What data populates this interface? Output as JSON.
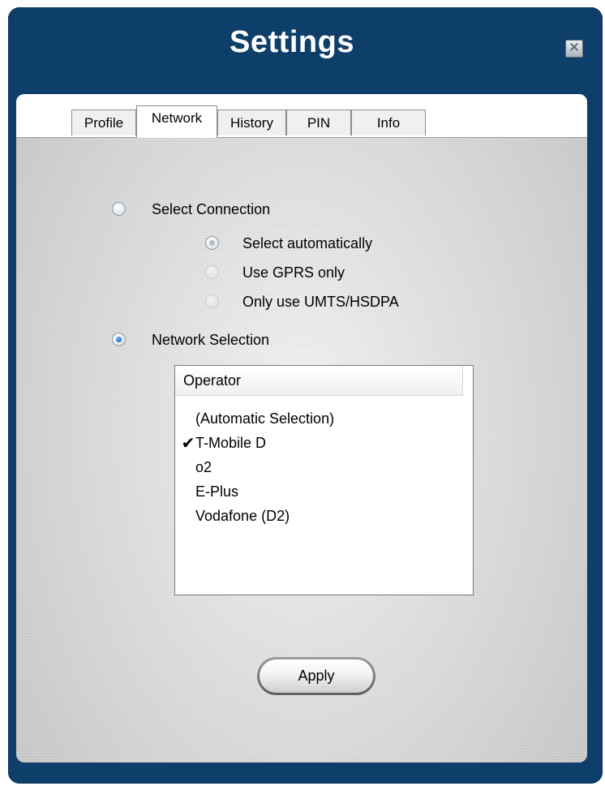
{
  "window": {
    "title": "Settings",
    "close_icon": "close-icon"
  },
  "tabs": [
    {
      "label": "Profile",
      "active": false
    },
    {
      "label": "Network",
      "active": true
    },
    {
      "label": "History",
      "active": false
    },
    {
      "label": "PIN",
      "active": false
    },
    {
      "label": "Info",
      "active": false
    }
  ],
  "connection": {
    "select_connection_label": "Select Connection",
    "select_connection_checked": false,
    "options": [
      {
        "label": "Select automatically",
        "checked": true,
        "enabled": false
      },
      {
        "label": "Use GPRS only",
        "checked": false,
        "enabled": false
      },
      {
        "label": "Only use UMTS/HSDPA",
        "checked": false,
        "enabled": false
      }
    ],
    "network_selection_label": "Network Selection",
    "network_selection_checked": true
  },
  "operators": {
    "header": "Operator",
    "items": [
      {
        "name": "(Automatic Selection)",
        "selected": false
      },
      {
        "name": "T-Mobile D",
        "selected": true
      },
      {
        "name": "o2",
        "selected": false
      },
      {
        "name": "E-Plus",
        "selected": false
      },
      {
        "name": "Vodafone (D2)",
        "selected": false
      }
    ],
    "check_mark": "✔"
  },
  "apply_label": "Apply",
  "colors": {
    "window_bg": "#0e3e6a",
    "title_text": "#ffffff",
    "radio_accent": "#1f5fbf"
  }
}
